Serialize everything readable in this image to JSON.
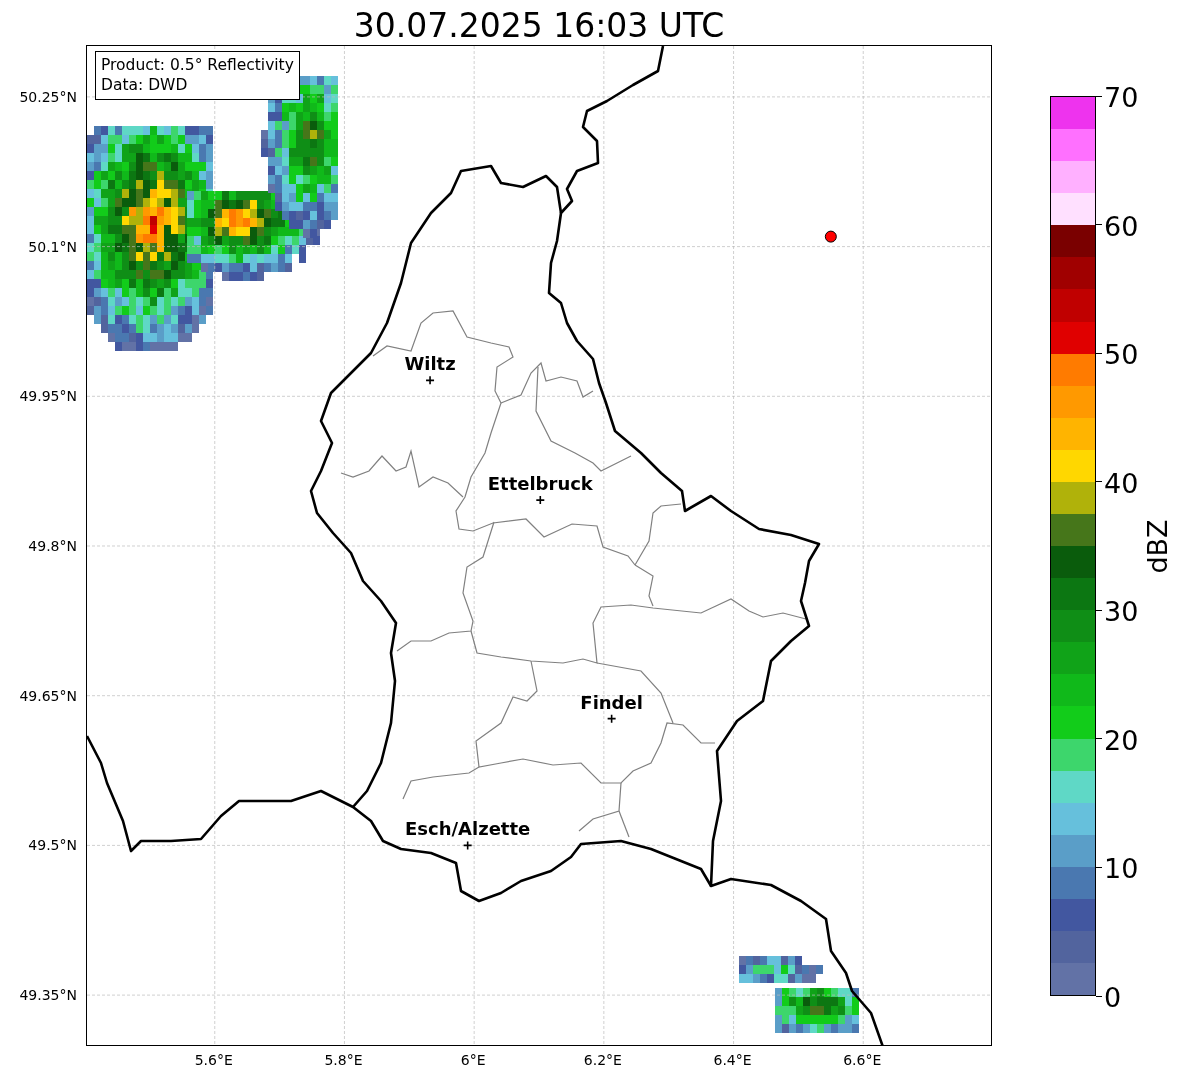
{
  "title": "30.07.2025 16:03 UTC",
  "annotation": {
    "lines": [
      "Product: 0.5° Reflectivity",
      "Data: DWD"
    ]
  },
  "map": {
    "longitude_labels": [
      "5.6°E",
      "5.8°E",
      "6°E",
      "6.2°E",
      "6.4°E",
      "6.6°E"
    ],
    "latitude_labels": [
      "50.25°N",
      "50.1°N",
      "49.95°N",
      "49.8°N",
      "49.65°N",
      "49.5°N",
      "49.35°N"
    ],
    "places": [
      "Wiltz",
      "Ettelbruck",
      "Findel",
      "Esch/Alzette"
    ]
  },
  "colorbar": {
    "label": "dBZ",
    "ticks": [
      "70",
      "60",
      "50",
      "40",
      "30",
      "20",
      "10",
      "0"
    ],
    "bands": [
      {
        "color": "#ee33ee"
      },
      {
        "color": "#ff70ff"
      },
      {
        "color": "#ffb0ff"
      },
      {
        "color": "#ffe0ff"
      },
      {
        "color": "#7a0000"
      },
      {
        "color": "#a00000"
      },
      {
        "color": "#c00000"
      },
      {
        "color": "#e00000"
      },
      {
        "color": "#ff7b00"
      },
      {
        "color": "#ff9900"
      },
      {
        "color": "#ffb400"
      },
      {
        "color": "#ffd700"
      },
      {
        "color": "#b0b20a"
      },
      {
        "color": "#46761a"
      },
      {
        "color": "#0a5c0c"
      },
      {
        "color": "#0c7712"
      },
      {
        "color": "#0f8e16"
      },
      {
        "color": "#10a318"
      },
      {
        "color": "#10b91a"
      },
      {
        "color": "#12cc1a"
      },
      {
        "color": "#3dd66c"
      },
      {
        "color": "#5fd8c6"
      },
      {
        "color": "#66c0dc"
      },
      {
        "color": "#5a9ec8"
      },
      {
        "color": "#4a78b0"
      },
      {
        "color": "#4257a0"
      },
      {
        "color": "#52649e"
      },
      {
        "color": "#6272a6"
      }
    ]
  }
}
